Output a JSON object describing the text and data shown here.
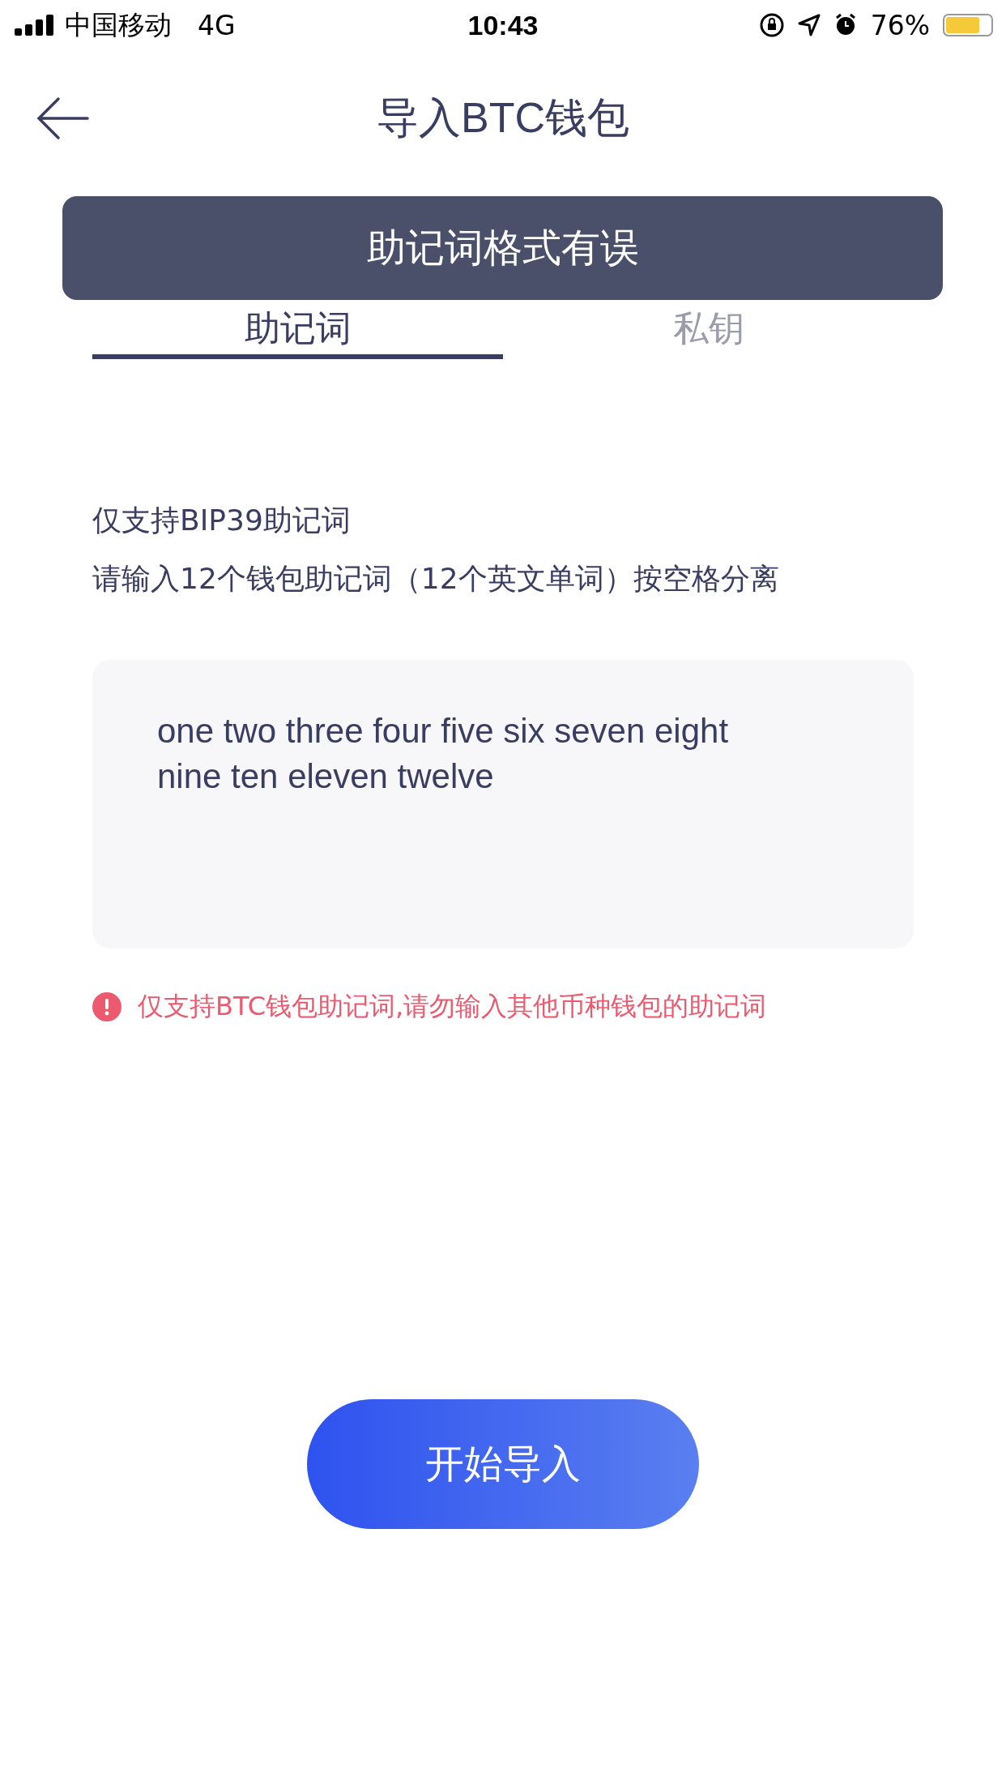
{
  "status_bar": {
    "carrier": "中国移动",
    "network": "4G",
    "time": "10:43",
    "battery": "76%"
  },
  "nav": {
    "title": "导入BTC钱包"
  },
  "toast": {
    "message": "助记词格式有误"
  },
  "tabs": [
    {
      "label": "助记词",
      "selected": true
    },
    {
      "label": "私钥",
      "selected": false
    }
  ],
  "hints": [
    "仅支持BIP39助记词",
    "请输入12个钱包助记词（12个英文单词）按空格分离"
  ],
  "mnemonic_field": {
    "value": "one two three four five six seven eight nine ten eleven twelve"
  },
  "error": {
    "message": "仅支持BTC钱包助记词,请勿输入其他币种钱包的助记词"
  },
  "primary_button": {
    "label": "开始导入"
  }
}
